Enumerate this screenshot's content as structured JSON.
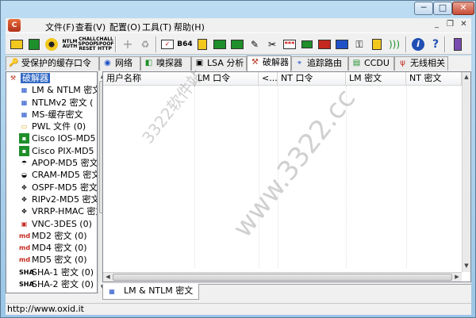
{
  "window": {
    "minimize_glyph": "─",
    "maximize_glyph": "□",
    "close_glyph": "✕"
  },
  "menubar": {
    "app_icon": "app-icon",
    "items": [
      "文件(F)",
      "查看(V)",
      "配置(O)",
      "工具(T)",
      "帮助(H)"
    ],
    "mdi_controls": [
      "_",
      "❐",
      "✕"
    ]
  },
  "toolbar": {
    "text_button_1": "NTLM AUTH",
    "text_button_2": "CHALL SPOOF RESET",
    "text_button_3": "CHALL SPOOF HTTP",
    "base64_label": "B64",
    "pwd_label": "***"
  },
  "tabs": [
    {
      "label": "受保护的缓存口令",
      "icon": "key-icon"
    },
    {
      "label": "网络",
      "icon": "network-icon"
    },
    {
      "label": "嗅探器",
      "icon": "sniffer-icon"
    },
    {
      "label": "LSA 分析",
      "icon": "lsa-icon"
    },
    {
      "label": "破解器",
      "icon": "cracker-icon",
      "active": true
    },
    {
      "label": "追踪路由",
      "icon": "traceroute-icon"
    },
    {
      "label": "CCDU",
      "icon": "ccdu-icon"
    },
    {
      "label": "无线相关",
      "icon": "wireless-icon"
    }
  ],
  "tree": {
    "root": "破解器",
    "items": [
      {
        "label": "LM & NTLM 密文",
        "icon": "lm-ntlm-icon"
      },
      {
        "label": "NTLMv2 密文 (",
        "icon": "ntlmv2-icon"
      },
      {
        "label": "MS-缓存密文",
        "icon": "ms-cache-icon"
      },
      {
        "label": "PWL 文件 (0)",
        "icon": "pwl-icon"
      },
      {
        "label": "Cisco IOS-MD5",
        "icon": "cisco-ios-icon"
      },
      {
        "label": "Cisco PIX-MD5 I",
        "icon": "cisco-pix-icon"
      },
      {
        "label": "APOP-MD5 密文",
        "icon": "apop-icon"
      },
      {
        "label": "CRAM-MD5 密文",
        "icon": "cram-icon"
      },
      {
        "label": "OSPF-MD5 密文",
        "icon": "ospf-icon"
      },
      {
        "label": "RIPv2-MD5 密文",
        "icon": "ripv2-icon"
      },
      {
        "label": "VRRP-HMAC 密文",
        "icon": "vrrp-icon"
      },
      {
        "label": "VNC-3DES (0)",
        "icon": "vnc-icon"
      },
      {
        "label": "MD2 密文 (0)",
        "icon": "md2-icon"
      },
      {
        "label": "MD4 密文 (0)",
        "icon": "md4-icon"
      },
      {
        "label": "MD5 密文 (0)",
        "icon": "md5-icon"
      },
      {
        "label": "SHA-1 密文 (0)",
        "icon": "sha1-icon"
      },
      {
        "label": "SHA-2 密文 (0)",
        "icon": "sha2-icon"
      }
    ],
    "scroll_up": "▲",
    "scroll_down": "▼"
  },
  "grid": {
    "columns": [
      "用户名称",
      "LM 口令",
      "<...",
      "NT 口令",
      "LM 密文",
      "NT 密文",
      ""
    ],
    "scroll_up": "▲",
    "scroll_down": "▼",
    "scroll_left": "◀",
    "scroll_right": "▶"
  },
  "bottom_tab": {
    "label": "LM & NTLM 密文",
    "icon": "lm-ntlm-icon"
  },
  "statusbar": {
    "text": "http://www.oxid.it"
  },
  "watermark": {
    "text": "www.3322.cc",
    "text2": "3322软件站"
  }
}
